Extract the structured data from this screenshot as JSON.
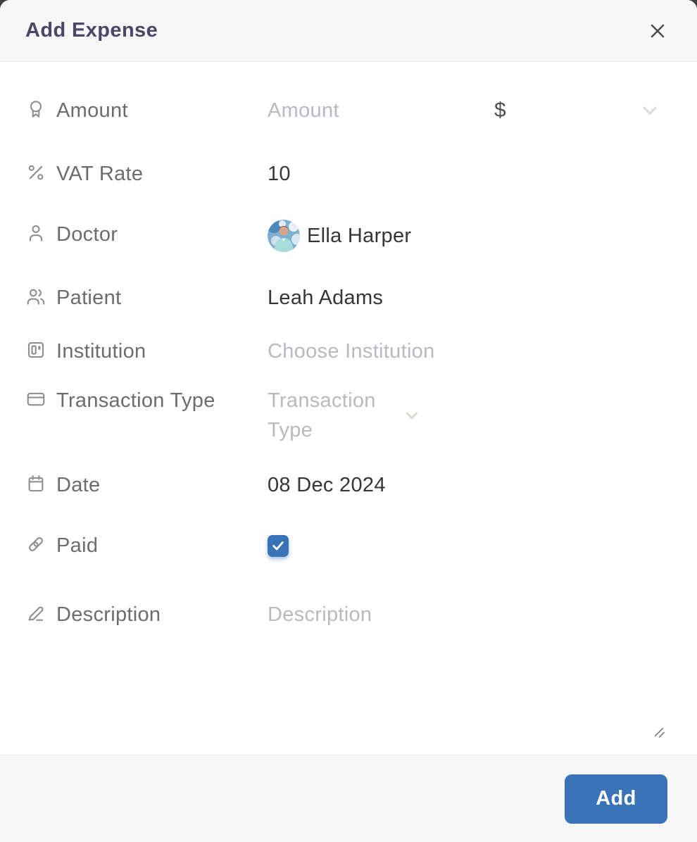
{
  "header": {
    "title": "Add Expense"
  },
  "form": {
    "amount": {
      "label": "Amount",
      "placeholder": "Amount",
      "currency": "$"
    },
    "vat_rate": {
      "label": "VAT Rate",
      "value": "10"
    },
    "doctor": {
      "label": "Doctor",
      "value": "Ella Harper"
    },
    "patient": {
      "label": "Patient",
      "value": "Leah Adams"
    },
    "institution": {
      "label": "Institution",
      "placeholder": "Choose Institution"
    },
    "transaction_type": {
      "label": "Transaction Type",
      "placeholder": "Transaction Type"
    },
    "date": {
      "label": "Date",
      "value": "08 Dec 2024"
    },
    "paid": {
      "label": "Paid",
      "checked": true
    },
    "description": {
      "label": "Description",
      "placeholder": "Description"
    }
  },
  "footer": {
    "add_button": "Add"
  },
  "icons": {
    "header_close": "close-icon",
    "amount": "award-icon",
    "vat_rate": "percent-icon",
    "doctor": "user-icon",
    "patient": "users-icon",
    "institution": "building-icon",
    "transaction_type": "credit-card-icon",
    "date": "calendar-icon",
    "paid": "link-icon",
    "description": "pen-icon",
    "dropdowns": "chevron-down-icon",
    "textarea": "resize-grip-icon"
  },
  "colors": {
    "accent_blue": "#3b73b9",
    "checkbox_blue": "#3a72b8",
    "title_color": "#4a4665",
    "header_bg": "#f7f7f8",
    "placeholder_gray": "#b9b9c1"
  }
}
